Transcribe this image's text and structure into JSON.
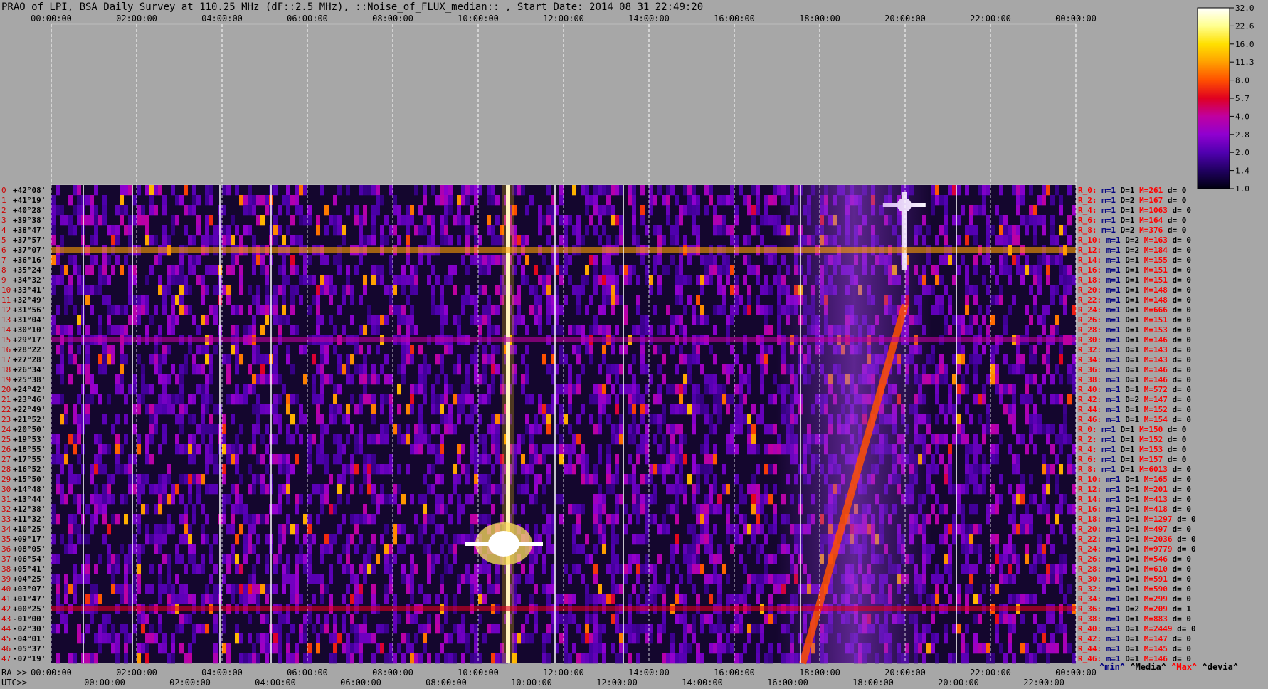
{
  "title": "PRAO of LPI, BSA Daily Survey at 110.25 MHz (dF::2.5 MHz), ::Noise_of_FLUX_median:: , Start Date: 2014 08 31 22:49:20",
  "chart_data": {
    "type": "heatmap",
    "top_axis_ticks": [
      "00:00:00",
      "02:00:00",
      "04:00:00",
      "06:00:00",
      "08:00:00",
      "10:00:00",
      "12:00:00",
      "14:00:00",
      "16:00:00",
      "18:00:00",
      "20:00:00",
      "22:00:00",
      "00:00:00"
    ],
    "ra_axis_label": "RA >>",
    "ra_ticks": [
      "00:00:00",
      "02:00:00",
      "04:00:00",
      "06:00:00",
      "08:00:00",
      "10:00:00",
      "12:00:00",
      "14:00:00",
      "16:00:00",
      "18:00:00",
      "20:00:00",
      "22:00:00",
      "00:00:00"
    ],
    "utc_axis_label": "UTC>>",
    "utc_ticks": [
      "00:00:00",
      "02:00:00",
      "04:00:00",
      "06:00:00",
      "08:00:00",
      "10:00:00",
      "12:00:00",
      "14:00:00",
      "16:00:00",
      "18:00:00",
      "20:00:00",
      "22:00:00"
    ],
    "declinations": [
      "+42°08'",
      "+41°19'",
      "+40°28'",
      "+39°38'",
      "+38°47'",
      "+37°57'",
      "+37°07'",
      "+36°16'",
      "+35°24'",
      "+34°32'",
      "+33°41'",
      "+32°49'",
      "+31°56'",
      "+31°04'",
      "+30°10'",
      "+29°17'",
      "+28°22'",
      "+27°28'",
      "+26°34'",
      "+25°38'",
      "+24°42'",
      "+23°46'",
      "+22°49'",
      "+21°52'",
      "+20°50'",
      "+19°53'",
      "+18°55'",
      "+17°55'",
      "+16°52'",
      "+15°50'",
      "+14°48'",
      "+13°44'",
      "+12°38'",
      "+11°32'",
      "+10°25'",
      "+09°17'",
      "+08°05'",
      "+06°54'",
      "+05°41'",
      "+04°25'",
      "+03°07'",
      "+01°47'",
      "+00°25'",
      "-01°00'",
      "-02°30'",
      "-04°01'",
      "-05°37'",
      "-07°19'"
    ],
    "row_numbers": [
      "0",
      "1",
      "2",
      "3",
      "4",
      "5",
      "6",
      "7",
      "8",
      "9",
      "10",
      "11",
      "12",
      "13",
      "14",
      "15",
      "16",
      "17",
      "18",
      "19",
      "20",
      "21",
      "22",
      "23",
      "24",
      "25",
      "26",
      "27",
      "28",
      "29",
      "30",
      "31",
      "32",
      "33",
      "34",
      "35",
      "36",
      "37",
      "38",
      "39",
      "40",
      "41",
      "42",
      "43",
      "44",
      "45",
      "46",
      "47"
    ],
    "stats": [
      {
        "r": "R_0:",
        "m": "m=1",
        "D": "D=1",
        "M": "M=261",
        "d": "d= 0"
      },
      {
        "r": "R_2:",
        "m": "m=1",
        "D": "D=2",
        "M": "M=167",
        "d": "d= 0"
      },
      {
        "r": "R_4:",
        "m": "m=1",
        "D": "D=1",
        "M": "M=1063",
        "d": "d= 0"
      },
      {
        "r": "R_6:",
        "m": "m=1",
        "D": "D=1",
        "M": "M=164",
        "d": "d= 0"
      },
      {
        "r": "R_8:",
        "m": "m=1",
        "D": "D=2",
        "M": "M=376",
        "d": "d= 0"
      },
      {
        "r": "R_10:",
        "m": "m=1",
        "D": "D=2",
        "M": "M=163",
        "d": "d= 0"
      },
      {
        "r": "R_12:",
        "m": "m=1",
        "D": "D=2",
        "M": "M=184",
        "d": "d= 0"
      },
      {
        "r": "R_14:",
        "m": "m=1",
        "D": "D=1",
        "M": "M=155",
        "d": "d= 0"
      },
      {
        "r": "R_16:",
        "m": "m=1",
        "D": "D=1",
        "M": "M=151",
        "d": "d= 0"
      },
      {
        "r": "R_18:",
        "m": "m=1",
        "D": "D=1",
        "M": "M=151",
        "d": "d= 0"
      },
      {
        "r": "R_20:",
        "m": "m=1",
        "D": "D=1",
        "M": "M=148",
        "d": "d= 0"
      },
      {
        "r": "R_22:",
        "m": "m=1",
        "D": "D=1",
        "M": "M=148",
        "d": "d= 0"
      },
      {
        "r": "R_24:",
        "m": "m=1",
        "D": "D=1",
        "M": "M=666",
        "d": "d= 0"
      },
      {
        "r": "R_26:",
        "m": "m=1",
        "D": "D=1",
        "M": "M=151",
        "d": "d= 0"
      },
      {
        "r": "R_28:",
        "m": "m=1",
        "D": "D=1",
        "M": "M=153",
        "d": "d= 0"
      },
      {
        "r": "R_30:",
        "m": "m=1",
        "D": "D=1",
        "M": "M=146",
        "d": "d= 0"
      },
      {
        "r": "R_32:",
        "m": "m=1",
        "D": "D=1",
        "M": "M=143",
        "d": "d= 0"
      },
      {
        "r": "R_34:",
        "m": "m=1",
        "D": "D=1",
        "M": "M=143",
        "d": "d= 0"
      },
      {
        "r": "R_36:",
        "m": "m=1",
        "D": "D=1",
        "M": "M=146",
        "d": "d= 0"
      },
      {
        "r": "R_38:",
        "m": "m=1",
        "D": "D=1",
        "M": "M=146",
        "d": "d= 0"
      },
      {
        "r": "R_40:",
        "m": "m=1",
        "D": "D=1",
        "M": "M=572",
        "d": "d= 0"
      },
      {
        "r": "R_42:",
        "m": "m=1",
        "D": "D=2",
        "M": "M=147",
        "d": "d= 0"
      },
      {
        "r": "R_44:",
        "m": "m=1",
        "D": "D=1",
        "M": "M=152",
        "d": "d= 0"
      },
      {
        "r": "R_46:",
        "m": "m=1",
        "D": "D=1",
        "M": "M=154",
        "d": "d= 0"
      },
      {
        "r": "R_0:",
        "m": "m=1",
        "D": "D=1",
        "M": "M=150",
        "d": "d= 0"
      },
      {
        "r": "R_2:",
        "m": "m=1",
        "D": "D=1",
        "M": "M=152",
        "d": "d= 0"
      },
      {
        "r": "R_4:",
        "m": "m=1",
        "D": "D=1",
        "M": "M=153",
        "d": "d= 0"
      },
      {
        "r": "R_6:",
        "m": "m=1",
        "D": "D=1",
        "M": "M=157",
        "d": "d= 0"
      },
      {
        "r": "R_8:",
        "m": "m=1",
        "D": "D=1",
        "M": "M=6013",
        "d": "d= 0"
      },
      {
        "r": "R_10:",
        "m": "m=1",
        "D": "D=1",
        "M": "M=165",
        "d": "d= 0"
      },
      {
        "r": "R_12:",
        "m": "m=1",
        "D": "D=1",
        "M": "M=201",
        "d": "d= 0"
      },
      {
        "r": "R_14:",
        "m": "m=1",
        "D": "D=1",
        "M": "M=413",
        "d": "d= 0"
      },
      {
        "r": "R_16:",
        "m": "m=1",
        "D": "D=1",
        "M": "M=418",
        "d": "d= 0"
      },
      {
        "r": "R_18:",
        "m": "m=1",
        "D": "D=1",
        "M": "M=1297",
        "d": "d= 0"
      },
      {
        "r": "R_20:",
        "m": "m=1",
        "D": "D=1",
        "M": "M=497",
        "d": "d= 0"
      },
      {
        "r": "R_22:",
        "m": "m=1",
        "D": "D=1",
        "M": "M=2036",
        "d": "d= 0"
      },
      {
        "r": "R_24:",
        "m": "m=1",
        "D": "D=1",
        "M": "M=9779",
        "d": "d= 0"
      },
      {
        "r": "R_26:",
        "m": "m=1",
        "D": "D=1",
        "M": "M=546",
        "d": "d= 0"
      },
      {
        "r": "R_28:",
        "m": "m=1",
        "D": "D=1",
        "M": "M=610",
        "d": "d= 0"
      },
      {
        "r": "R_30:",
        "m": "m=1",
        "D": "D=1",
        "M": "M=591",
        "d": "d= 0"
      },
      {
        "r": "R_32:",
        "m": "m=1",
        "D": "D=1",
        "M": "M=590",
        "d": "d= 0"
      },
      {
        "r": "R_34:",
        "m": "m=1",
        "D": "D=1",
        "M": "M=299",
        "d": "d= 0"
      },
      {
        "r": "R_36:",
        "m": "m=1",
        "D": "D=2",
        "M": "M=209",
        "d": "d= 1"
      },
      {
        "r": "R_38:",
        "m": "m=1",
        "D": "D=1",
        "M": "M=883",
        "d": "d= 0"
      },
      {
        "r": "R_40:",
        "m": "m=1",
        "D": "D=1",
        "M": "M=2449",
        "d": "d= 0"
      },
      {
        "r": "R_42:",
        "m": "m=1",
        "D": "D=1",
        "M": "M=147",
        "d": "d= 0"
      },
      {
        "r": "R_44:",
        "m": "m=1",
        "D": "D=1",
        "M": "M=145",
        "d": "d= 0"
      },
      {
        "r": "R_46:",
        "m": "m=1",
        "D": "D=1",
        "M": "M=146",
        "d": "d= 0"
      }
    ],
    "legend": [
      {
        "label": "^min^",
        "color": "#000080"
      },
      {
        "label": "^Media^",
        "color": "#000000"
      },
      {
        "label": "^Max^",
        "color": "#ff0000"
      },
      {
        "label": "^devia^",
        "color": "#000000"
      }
    ],
    "colorbar": {
      "ticks": [
        "32.0",
        "22.6",
        "16.0",
        "11.3",
        "8.0",
        "5.7",
        "4.0",
        "2.8",
        "2.0",
        "1.4",
        "1.0"
      ],
      "tick_values": [
        32.0,
        22.6,
        16.0,
        11.3,
        8.0,
        5.7,
        4.0,
        2.8,
        2.0,
        1.4,
        1.0
      ],
      "scale": "log",
      "colors": [
        "#ffffff",
        "#ffff90",
        "#ffe000",
        "#ffa000",
        "#ff5000",
        "#e00020",
        "#c000a0",
        "#9000d0",
        "#5000b0",
        "#200060",
        "#000010"
      ]
    },
    "features": [
      {
        "name": "vertical-source-track",
        "ra_hours": 10.7,
        "value": 32.0
      },
      {
        "name": "bright-source-burst",
        "ra_hours": 10.6,
        "dec": "+08°05'",
        "value": 32.0
      },
      {
        "name": "bright-source",
        "ra_hours": 19.98,
        "dec": "+40°28'",
        "value": 32.0
      },
      {
        "name": "galactic-plane-band",
        "ra_hours": 18.8,
        "value": 8.0
      },
      {
        "name": "horizontal-band",
        "dec": "+00°25'",
        "value": 5.7
      },
      {
        "name": "horizontal-band",
        "dec": "+29°17'",
        "value": 4.0
      },
      {
        "name": "horizontal-band",
        "dec": "+37°07'",
        "value": 11.3
      }
    ]
  }
}
